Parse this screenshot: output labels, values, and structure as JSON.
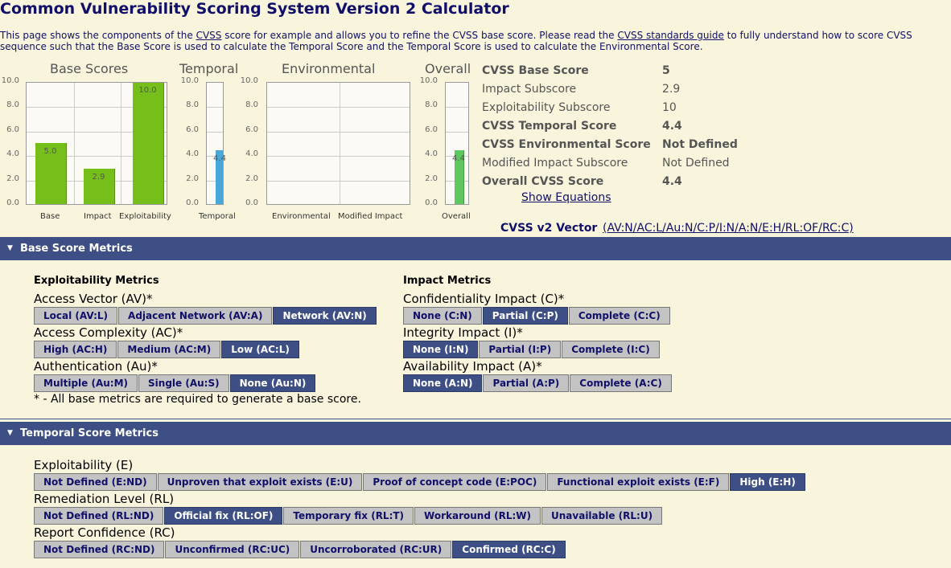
{
  "page": {
    "title": "Common Vulnerability Scoring System Version 2 Calculator",
    "intro": {
      "t1": "This page shows the components of the ",
      "link1": "CVSS",
      "t2": " score for example and allows you to refine the CVSS base score. Please read the ",
      "link2": "CVSS standards guide",
      "t3": " to fully understand how to score CVSS",
      "line2": "sequence such that the Base Score is used to calculate the Temporal Score and the Temporal Score is used to calculate the Environmental Score."
    }
  },
  "charts": {
    "base": {
      "title": "Base Scores",
      "ticks": [
        "10.0",
        "8.0",
        "6.0",
        "4.0",
        "2.0",
        "0.0"
      ],
      "bars": [
        {
          "category": "Base",
          "value": 5.0,
          "label": "5.0",
          "color": "#76bf1b"
        },
        {
          "category": "Impact",
          "value": 2.9,
          "label": "2.9",
          "color": "#76bf1b"
        },
        {
          "category": "Exploitability",
          "value": 10.0,
          "label": "10.0",
          "color": "#76bf1b"
        }
      ]
    },
    "temporal": {
      "title": "Temporal",
      "ticks": [
        "10.0",
        "8.0",
        "6.0",
        "4.0",
        "2.0",
        "0.0"
      ],
      "bars": [
        {
          "category": "Temporal",
          "value": 4.4,
          "label": "4.4",
          "color": "#4aa8d8"
        }
      ]
    },
    "environmental": {
      "title": "Environmental",
      "ticks": [
        "10.0",
        "8.0",
        "6.0",
        "4.0",
        "2.0",
        "0.0"
      ],
      "categories": [
        "Environmental",
        "Modified Impact"
      ]
    },
    "overall": {
      "title": "Overall",
      "ticks": [
        "10.0",
        "8.0",
        "6.0",
        "4.0",
        "2.0",
        "0.0"
      ],
      "bars": [
        {
          "category": "Overall",
          "value": 4.4,
          "label": "4.4",
          "color": "#5dc85d"
        }
      ]
    }
  },
  "chart_data": [
    {
      "type": "bar",
      "title": "Base Scores",
      "categories": [
        "Base",
        "Impact",
        "Exploitability"
      ],
      "values": [
        5.0,
        2.9,
        10.0
      ],
      "ylim": [
        0,
        10
      ]
    },
    {
      "type": "bar",
      "title": "Temporal",
      "categories": [
        "Temporal"
      ],
      "values": [
        4.4
      ],
      "ylim": [
        0,
        10
      ]
    },
    {
      "type": "bar",
      "title": "Environmental",
      "categories": [
        "Environmental",
        "Modified Impact"
      ],
      "values": [
        null,
        null
      ],
      "ylim": [
        0,
        10
      ]
    },
    {
      "type": "bar",
      "title": "Overall",
      "categories": [
        "Overall"
      ],
      "values": [
        4.4
      ],
      "ylim": [
        0,
        10
      ]
    }
  ],
  "scores": [
    {
      "label": "CVSS Base Score",
      "value": "5",
      "bold": true
    },
    {
      "label": "Impact Subscore",
      "value": "2.9",
      "bold": false
    },
    {
      "label": "Exploitability Subscore",
      "value": "10",
      "bold": false
    },
    {
      "label": "CVSS Temporal Score",
      "value": "4.4",
      "bold": true
    },
    {
      "label": "CVSS Environmental Score",
      "value": "Not Defined",
      "bold": true
    },
    {
      "label": "Modified Impact Subscore",
      "value": "Not Defined",
      "bold": false
    },
    {
      "label": "Overall CVSS Score",
      "value": "4.4",
      "bold": true
    }
  ],
  "show_equations": "Show Equations",
  "vector": {
    "label": "CVSS v2 Vector",
    "value": "(AV:N/AC:L/Au:N/C:P/I:N/A:N/E:H/RL:OF/RC:C)"
  },
  "base_section": {
    "header": "Base Score Metrics",
    "exploitability_title": "Exploitability Metrics",
    "impact_title": "Impact Metrics",
    "metrics": [
      {
        "label": "Access Vector (AV)*",
        "options": [
          "Local (AV:L)",
          "Adjacent Network (AV:A)",
          "Network (AV:N)"
        ],
        "selected": 2
      },
      {
        "label": "Access Complexity (AC)*",
        "options": [
          "High (AC:H)",
          "Medium (AC:M)",
          "Low (AC:L)"
        ],
        "selected": 2
      },
      {
        "label": "Authentication (Au)*",
        "options": [
          "Multiple (Au:M)",
          "Single (Au:S)",
          "None (Au:N)"
        ],
        "selected": 2
      },
      {
        "label": "Confidentiality Impact (C)*",
        "options": [
          "None (C:N)",
          "Partial (C:P)",
          "Complete (C:C)"
        ],
        "selected": 1
      },
      {
        "label": "Integrity Impact (I)*",
        "options": [
          "None (I:N)",
          "Partial (I:P)",
          "Complete (I:C)"
        ],
        "selected": 0
      },
      {
        "label": "Availability Impact (A)*",
        "options": [
          "None (A:N)",
          "Partial (A:P)",
          "Complete (A:C)"
        ],
        "selected": 0
      }
    ],
    "note": "* - All base metrics are required to generate a base score."
  },
  "temporal_section": {
    "header": "Temporal Score Metrics",
    "metrics": [
      {
        "label": "Exploitability (E)",
        "options": [
          "Not Defined (E:ND)",
          "Unproven that exploit exists (E:U)",
          "Proof of concept code (E:POC)",
          "Functional exploit exists (E:F)",
          "High (E:H)"
        ],
        "selected": 4
      },
      {
        "label": "Remediation Level (RL)",
        "options": [
          "Not Defined (RL:ND)",
          "Official fix (RL:OF)",
          "Temporary fix (RL:T)",
          "Workaround (RL:W)",
          "Unavailable (RL:U)"
        ],
        "selected": 1
      },
      {
        "label": "Report Confidence (RC)",
        "options": [
          "Not Defined (RC:ND)",
          "Unconfirmed (RC:UC)",
          "Uncorroborated (RC:UR)",
          "Confirmed (RC:C)"
        ],
        "selected": 3
      }
    ]
  }
}
